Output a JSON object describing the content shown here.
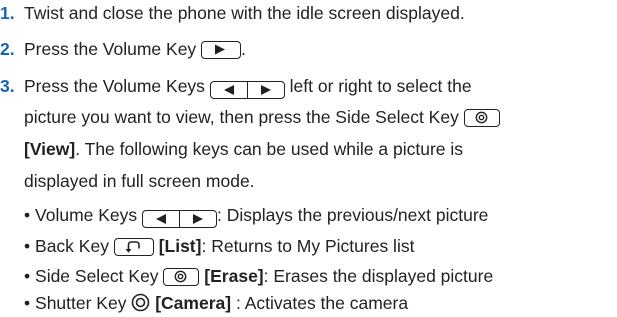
{
  "steps": [
    {
      "number": "1.",
      "text": "Twist and close the phone with the idle screen displayed."
    },
    {
      "number": "2.",
      "text_before": "Press the Volume Key ",
      "text_after": "."
    },
    {
      "number": "3.",
      "line1_before": "Press the Volume Keys ",
      "line1_after": " left or right to select the",
      "line2_before": "picture you want to view, then press the Side Select Key",
      "line3_bold": "[View]",
      "line3_after": ". The following keys can be used while a picture is",
      "line4": "displayed in full screen mode."
    }
  ],
  "bullets": [
    {
      "bullet": "•",
      "label": "Volume Keys ",
      "action": ": Displays the previous/next picture"
    },
    {
      "bullet": "•",
      "label": "Back Key ",
      "softkey": "[List]",
      "action": ": Returns to My Pictures list"
    },
    {
      "bullet": "•",
      "label": "Side Select Key ",
      "softkey": "[Erase]",
      "action": ": Erases the displayed picture"
    },
    {
      "bullet": "•",
      "label": "Shutter Key ",
      "softkey": "[Camera]",
      "action": " : Activates the camera"
    }
  ],
  "icons": {
    "volume_right": "volume-right-key-icon",
    "volume_left_right": "volume-left-right-keys-icon",
    "side_select": "side-select-key-icon",
    "back": "back-key-icon",
    "shutter": "shutter-key-icon"
  },
  "colors": {
    "step_number": "#1565b4",
    "text": "#222222"
  }
}
